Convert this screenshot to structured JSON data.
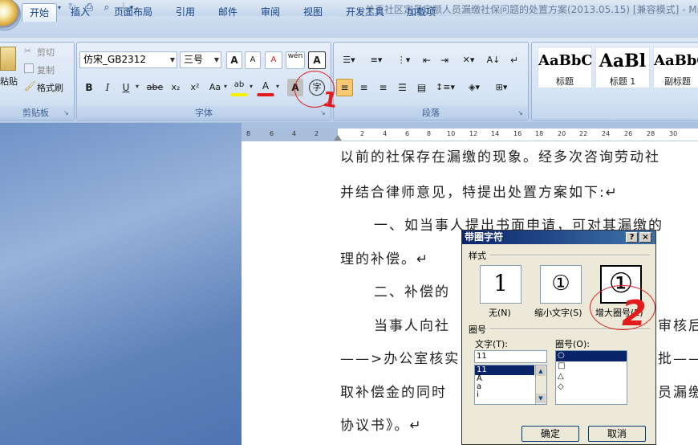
{
  "window": {
    "title": "关于社区定员定额人员漏缴社保问题的处置方案(2013.05.15) [兼容模式] - Mic"
  },
  "quick_access": [
    {
      "icon": "save-icon",
      "glyph": "💾"
    },
    {
      "icon": "undo-icon",
      "glyph": "↶"
    },
    {
      "icon": "redo-icon",
      "glyph": "↻"
    },
    {
      "icon": "print-icon",
      "glyph": "🖶"
    },
    {
      "icon": "print-preview-icon",
      "glyph": "🔍"
    },
    {
      "icon": "customize-icon",
      "glyph": "▾"
    }
  ],
  "tabs": [
    "开始",
    "插入",
    "页面布局",
    "引用",
    "邮件",
    "审阅",
    "视图",
    "开发工具",
    "加载项"
  ],
  "clipboard": {
    "paste": "粘贴",
    "cut": "剪切",
    "copy": "复制",
    "format_painter": "格式刷",
    "label": "剪贴板"
  },
  "font": {
    "name": "仿宋_GB2312",
    "size": "三号",
    "label": "字体",
    "grow": "A",
    "shrink": "A",
    "clear": "A",
    "phonetic": "wén",
    "border": "A",
    "bold": "B",
    "italic": "I",
    "underline": "U",
    "strike": "abe",
    "sub": "x₂",
    "sup": "x²",
    "case": "Aa",
    "highlight": "ab",
    "color": "A",
    "shade": "A",
    "enclose": "字"
  },
  "paragraph": {
    "label": "段落"
  },
  "styles": [
    {
      "sample": "AaBbC",
      "name": "标题"
    },
    {
      "sample": "AaBl",
      "name": "标题 1"
    },
    {
      "sample": "AaBbC",
      "name": "副标题"
    }
  ],
  "ruler": [
    "8",
    "6",
    "4",
    "2",
    "2",
    "4",
    "6",
    "8",
    "10",
    "12",
    "14",
    "16",
    "18",
    "20",
    "22",
    "24",
    "26",
    "28",
    "30"
  ],
  "document": {
    "lines": [
      "以前的社保存在漏缴的现象。经多次咨询劳动社",
      "并结合律师意见，特提出处置方案如下:↵",
      "一、如当事人提出书面申请，可对其漏缴的",
      "理的补偿。↵",
      "二、补偿的",
      "当事人向社",
      "审核后",
      "——>办公室核实",
      "批——",
      "取补偿金的同时",
      "员漏缴",
      "协议书》。↵"
    ]
  },
  "dialog": {
    "title": "带圈字符",
    "help": "?",
    "close": "×",
    "style_label": "样式",
    "options": [
      {
        "name": "无(N)",
        "glyph": "1"
      },
      {
        "name": "缩小文字(S)",
        "glyph": "①"
      },
      {
        "name": "增大圈号(E)",
        "glyph": "①"
      }
    ],
    "circle_section": "圈号",
    "text_label": "文字(T):",
    "text_value": "11",
    "text_items": [
      "11",
      "Å",
      "a",
      "i"
    ],
    "shape_label": "圈号(O):",
    "shape_items": [
      "○",
      "□",
      "△",
      "◇"
    ],
    "ok": "确定",
    "cancel": "取消"
  },
  "annotations": {
    "one": "1",
    "two": "2"
  },
  "colors": {
    "highlight": "#f7f300",
    "font_color": "#e21c1c",
    "annotation": "#e21c1c"
  }
}
